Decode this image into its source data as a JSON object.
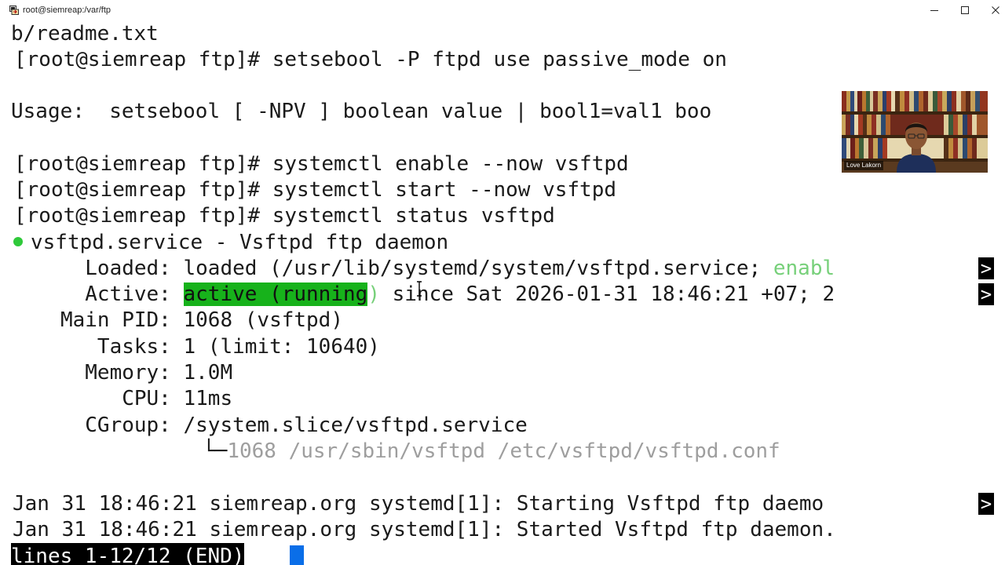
{
  "window": {
    "title": "root@siemreap:/var/ftp",
    "icon": "putty-terminal-icon",
    "controls": [
      "minimize",
      "maximize",
      "close"
    ]
  },
  "terminal": {
    "line1": "b/readme.txt",
    "line2": "[root@siemreap ftp]# setsebool -P ftpd use passive_mode on",
    "line3": "Usage:  setsebool [ -NPV ] boolean value | bool1=val1 boo",
    "line4": "[root@siemreap ftp]# systemctl enable --now vsftpd",
    "line5": "[root@siemreap ftp]# systemctl start --now vsftpd",
    "line6": "[root@siemreap ftp]# systemctl status vsftpd",
    "service_line": "vsftpd.service - Vsftpd ftp daemon",
    "loaded_label": "     Loaded: ",
    "loaded_value": "loaded (/usr/lib/systemd/system/vsftpd.service; ",
    "loaded_enabled": "enabl",
    "active_label": "     Active: ",
    "active_state": "active (running",
    "active_paren": ")",
    "active_since": " since Sat 2026-01-31 18:46:21 +07; 2",
    "pid_line": "   Main PID: 1068 (vsftpd)",
    "tasks_line": "      Tasks: 1 (limit: 10640)",
    "memory_line": "     Memory: 1.0M",
    "cpu_line": "        CPU: 11ms",
    "cgroup_line": "     CGroup: /system.slice/vsftpd.service",
    "cgroup_tree": "└─",
    "cgroup_proc": "1068 /usr/sbin/vsftpd /etc/vsftpd/vsftpd.conf",
    "log1": "Jan 31 18:46:21 siemreap.org systemd[1]: Starting Vsftpd ftp daemo",
    "log2": "Jan 31 18:46:21 siemreap.org systemd[1]: Started Vsftpd ftp daemon.",
    "pager_status": "lines 1-12/12 (END)",
    "overflow_marker": ">"
  },
  "video_overlay": {
    "participant_name": "Love Lakorn"
  },
  "colors": {
    "active_highlight": "#17b21b",
    "enabled_text": "#77d07a",
    "status_bullet": "#2fc93a",
    "cursor": "#0a6ee8"
  }
}
